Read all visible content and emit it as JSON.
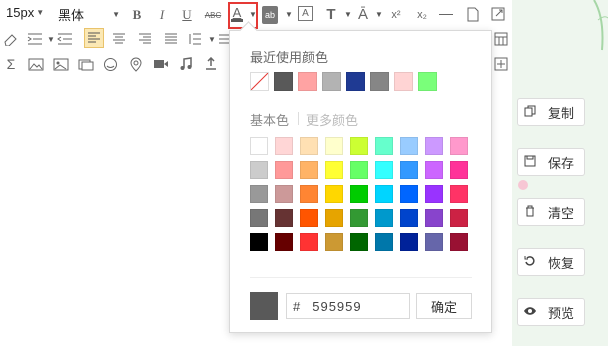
{
  "toolbar": {
    "font_size": "15px",
    "font_family": "黑体",
    "bold": "B",
    "italic": "I",
    "underline": "U",
    "strikethrough": "ABC",
    "font_color": "A",
    "bg_color": "ab",
    "border_text": "A",
    "superscript": "x²",
    "subscript": "x₂"
  },
  "side_buttons": [
    {
      "label": "复制",
      "icon": "copy-icon"
    },
    {
      "label": "保存",
      "icon": "save-icon"
    },
    {
      "label": "清空",
      "icon": "trash-icon"
    },
    {
      "label": "恢复",
      "icon": "restore-icon"
    },
    {
      "label": "预览",
      "icon": "eye-icon"
    }
  ],
  "color_picker": {
    "recent_title": "最近使用颜色",
    "basic_title": "基本色",
    "more_colors": "更多颜色",
    "recent_colors": [
      "none",
      "#595959",
      "#ffa3a3",
      "#b3b3b3",
      "#1f3a93",
      "#868686",
      "#ffd4d4",
      "#7aff7a"
    ],
    "basic_colors": [
      [
        "#ffffff",
        "#ffd6d6",
        "#ffe0b3",
        "#ffffcc",
        "#ccff33",
        "#66ffcc",
        "#99ccff",
        "#cc99ff",
        "#ff99cc"
      ],
      [
        "#cccccc",
        "#ff9999",
        "#ffb366",
        "#ffff33",
        "#66ff66",
        "#33ffff",
        "#3399ff",
        "#cc66ff",
        "#ff3399"
      ],
      [
        "#999999",
        "#cc9999",
        "#ff8533",
        "#ffd700",
        "#00cc00",
        "#00d5ff",
        "#0066ff",
        "#9933ff",
        "#ff3366"
      ],
      [
        "#777777",
        "#663333",
        "#ff5500",
        "#e6a400",
        "#339933",
        "#0099cc",
        "#0044cc",
        "#8844cc",
        "#cc2244"
      ],
      [
        "#000000",
        "#660000",
        "#ff3333",
        "#cc9933",
        "#006600",
        "#0077aa",
        "#002299",
        "#6666aa",
        "#991133"
      ]
    ],
    "hex_prefix": "#",
    "hex_value": "595959",
    "preview_color": "#595959",
    "confirm": "确定"
  },
  "colors": {
    "highlight_box": "#e53935",
    "arrow": "#e53935"
  }
}
